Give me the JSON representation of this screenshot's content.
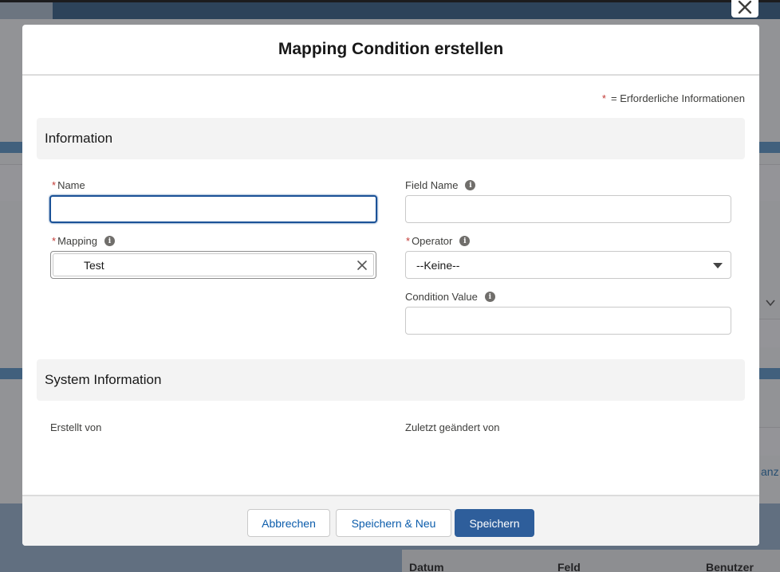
{
  "background": {
    "link_fragment": "anz",
    "table_headers": [
      "Datum",
      "Feld",
      "Benutzer"
    ]
  },
  "modal": {
    "title": "Mapping Condition erstellen",
    "required_legend": {
      "star": "*",
      "text": "= Erforderliche Informationen"
    },
    "sections": {
      "information": "Information",
      "system_information": "System Information"
    },
    "fields": {
      "name": {
        "label": "Name",
        "required": "*",
        "value": ""
      },
      "field_name": {
        "label": "Field Name",
        "value": ""
      },
      "mapping": {
        "label": "Mapping",
        "required": "*",
        "value": "Test"
      },
      "operator": {
        "label": "Operator",
        "required": "*",
        "value": "--Keine--"
      },
      "condition_value": {
        "label": "Condition Value",
        "value": ""
      }
    },
    "system_fields": {
      "created_by": "Erstellt von",
      "last_modified_by": "Zuletzt geändert von"
    },
    "footer": {
      "cancel": "Abbrechen",
      "save_new": "Speichern & Neu",
      "save": "Speichern"
    }
  },
  "icons": {
    "info": "i",
    "close": "close-icon",
    "clear": "clear-icon",
    "caret": "chevron-down-icon"
  },
  "colors": {
    "brand_button": "#2e5e9b",
    "focus_border": "#1b5297",
    "required_star": "#c23934",
    "link": "#0b5cab"
  }
}
